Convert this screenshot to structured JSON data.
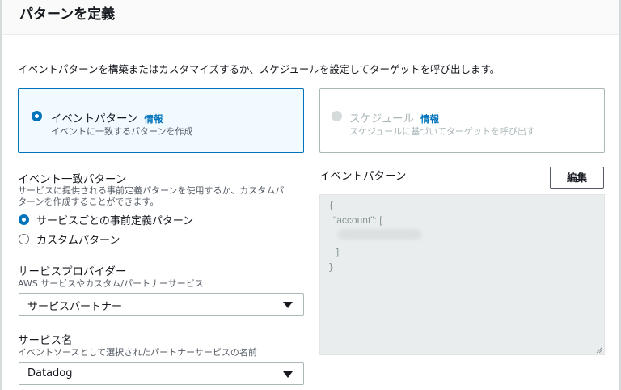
{
  "header": {
    "title": "パターンを定義"
  },
  "description": "イベントパターンを構築またはカスタマイズするか、スケジュールを設定してターゲットを呼び出します。",
  "pattern_type": {
    "event": {
      "title": "イベントパターン",
      "info": "情報",
      "subtitle": "イベントに一致するパターンを作成",
      "selected": true
    },
    "schedule": {
      "title": "スケジュール",
      "info": "情報",
      "subtitle": "スケジュールに基づいてターゲットを呼び出す",
      "disabled": true
    }
  },
  "event_match": {
    "label": "イベント一致パターン",
    "help_line1": "サービスに提供される事前定義パターンを使用するか、カスタムパ",
    "help_line2": "ターンを作成することができます。",
    "options": [
      {
        "label": "サービスごとの事前定義パターン",
        "selected": true
      },
      {
        "label": "カスタムパターン",
        "selected": false
      }
    ]
  },
  "service_provider": {
    "label": "サービスプロバイダー",
    "help": "AWS サービスやカスタム/パートナーサービス",
    "value": "サービスパートナー"
  },
  "service_name": {
    "label": "サービス名",
    "help": "イベントソースとして選択されたパートナーサービスの名前",
    "value": "Datadog"
  },
  "event_pattern_panel": {
    "label": "イベントパターン",
    "edit_button": "編集",
    "code_lines": [
      "{",
      "\"account\": [",
      "]",
      "}"
    ]
  }
}
